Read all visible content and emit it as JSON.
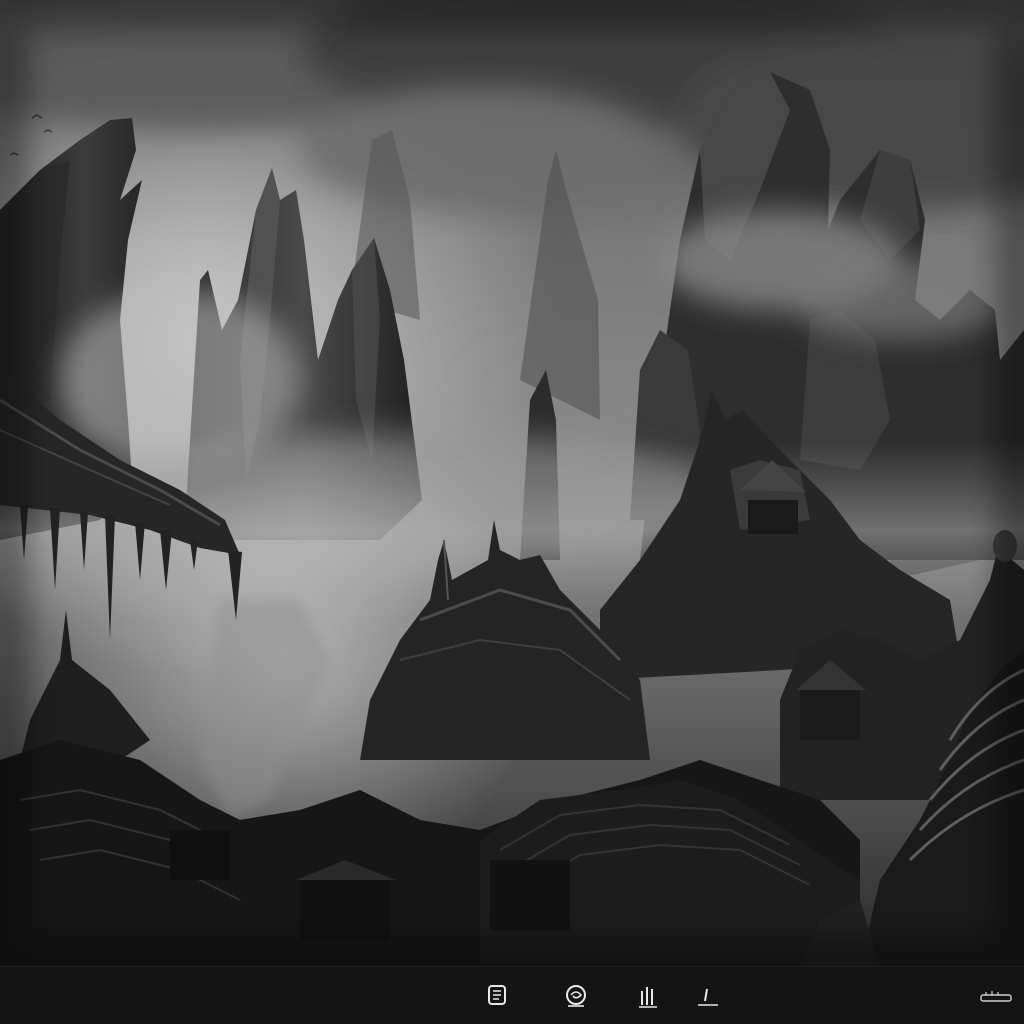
{
  "scene": {
    "subject": "monochrome-fantasy-landscape",
    "palette": {
      "sky_light": "#9a9a9a",
      "sky_mid": "#6a6a6a",
      "fog": "#b8b8b8",
      "rock_dark": "#1e1e1e",
      "rock_mid": "#3a3a3a",
      "rock_light": "#5c5c5c",
      "roof_dark": "#151515"
    }
  },
  "taskbar": {
    "background": "#141414",
    "icons": [
      {
        "name": "app-glyph-1-icon"
      },
      {
        "name": "app-glyph-2-icon"
      },
      {
        "name": "app-glyph-3-icon"
      },
      {
        "name": "app-glyph-4-icon"
      }
    ],
    "tray": {
      "name": "system-tray-icon"
    }
  }
}
